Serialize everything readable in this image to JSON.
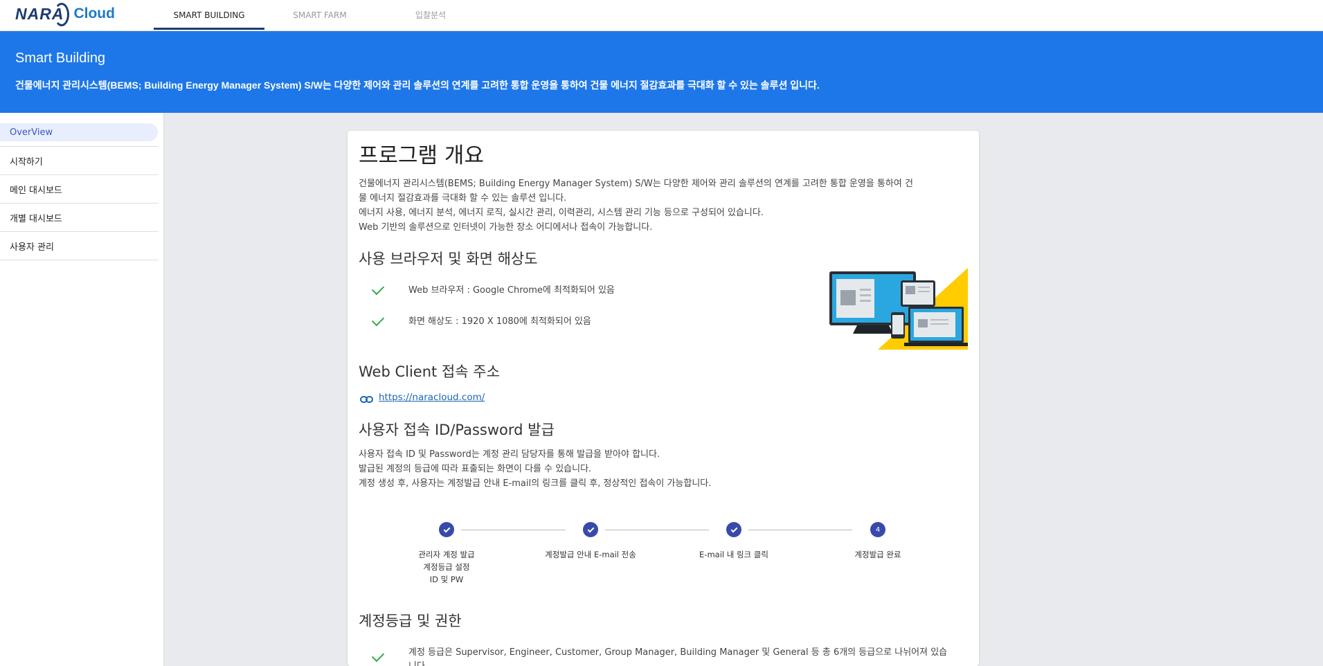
{
  "brand": {
    "name": "NARA",
    "product": "Cloud"
  },
  "nav": {
    "tabs": [
      {
        "label": "SMART BUILDING"
      },
      {
        "label": "SMART FARM"
      },
      {
        "label": "입찰분석"
      }
    ]
  },
  "hero": {
    "title": "Smart Building",
    "description": "건물에너지 관리시스템(BEMS; Building Energy Manager System) S/W는 다양한 제어와 관리 솔루션의 연계를 고려한 통합 운영을 통하여 건물 에너지 절감효과를 극대화 할 수 있는 솔루션 입니다."
  },
  "sidebar": {
    "items": [
      {
        "label": "OverView"
      },
      {
        "label": "시작하기"
      },
      {
        "label": "메인 대시보드"
      },
      {
        "label": "개별 대시보드"
      },
      {
        "label": "사용자 관리"
      }
    ]
  },
  "content": {
    "title": "프로그램 개요",
    "intro": [
      "건물에너지 관리시스템(BEMS; Building Energy Manager System) S/W는 다양한 제어와 관리 솔루션의 연계를 고려한 통합 운영을 통하여 건",
      "물 에너지 절감효과를 극대화 할 수 있는 솔루션 입니다.",
      "에너지 사용, 에너지 분석, 에너지 로직, 실시간 관리, 이력관리, 시스템 관리 기능 등으로 구성되어 있습니다.",
      "Web 기반의 솔루션으로 인터넷이 가능한 장소 어디에서나 접속이 가능합니다."
    ],
    "browser_section": {
      "title": "사용 브라우저 및 화면 해상도",
      "items": [
        "Web 브라우저 : Google Chrome에 최적화되어 있음",
        "화면 해상도 : 1920 X 1080에 최적화되어 있음"
      ]
    },
    "webclient_section": {
      "title": "Web Client 접속 주소",
      "url": "https://naracloud.com/"
    },
    "account_section": {
      "title": "사용자 접속 ID/Password 발급",
      "lines": [
        "사용자 접속 ID 및 Password는 계정 관리 담당자를 통해 발급을 받아야 합니다.",
        "발급된 계정의 등급에 따라 표출되는 화면이 다를 수 있습니다.",
        "계정 생성 후, 사용자는 계정발급 안내 E-mail의 링크를 클릭 후, 정상적인 접속이 가능합니다."
      ],
      "steps": [
        {
          "label_lines": [
            "관리자 계정 발급",
            "계정등급 설정",
            "ID 및 PW"
          ],
          "state": "done"
        },
        {
          "label_lines": [
            "계정발급 안내 E-mail 전송"
          ],
          "state": "done"
        },
        {
          "label_lines": [
            "E-mail 내 링크 클릭"
          ],
          "state": "done"
        },
        {
          "label_lines": [
            "계정발급 완료"
          ],
          "state": "current",
          "number": "4"
        }
      ]
    },
    "grade_section": {
      "title": "계정등급 및 권한",
      "items": [
        "계정 등급은 Supervisor, Engineer, Customer, Group Manager, Building Manager 및 General 등 총 6개의 등급으로 나뉘어져 있습",
        "니다."
      ]
    }
  },
  "colors": {
    "hero_bg": "#1e77e8",
    "step_active": "#3949ab",
    "check": "#3aa651",
    "link": "#1a64b7",
    "illustration_yellow": "#ffcc00",
    "illustration_blue": "#2ba7e0"
  }
}
